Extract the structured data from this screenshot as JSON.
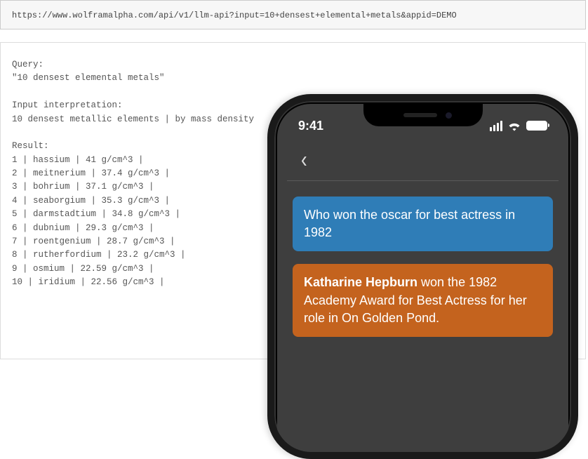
{
  "api": {
    "url": "https://www.wolframalpha.com/api/v1/llm-api?input=10+densest+elemental+metals&appid=DEMO",
    "query_label": "Query:",
    "query_value": "\"10 densest elemental metals\"",
    "interp_label": "Input interpretation:",
    "interp_value": "10 densest metallic elements | by mass density",
    "result_label": "Result:",
    "results": [
      "1 | hassium | 41 g/cm^3 |",
      "2 | meitnerium | 37.4 g/cm^3 |",
      "3 | bohrium | 37.1 g/cm^3 |",
      "4 | seaborgium | 35.3 g/cm^3 |",
      "5 | darmstadtium | 34.8 g/cm^3 |",
      "6 | dubnium | 29.3 g/cm^3 |",
      "7 | roentgenium | 28.7 g/cm^3 |",
      "8 | rutherfordium | 23.2 g/cm^3 |",
      "9 | osmium | 22.59 g/cm^3 |",
      "10 | iridium | 22.56 g/cm^3 |"
    ]
  },
  "phone": {
    "time": "9:41",
    "user_message": "Who won the oscar for best actress in 1982",
    "assistant_bold": "Katharine Hepburn",
    "assistant_rest": " won the 1982 Academy Award for Best Actress for her role in On Golden Pond."
  }
}
